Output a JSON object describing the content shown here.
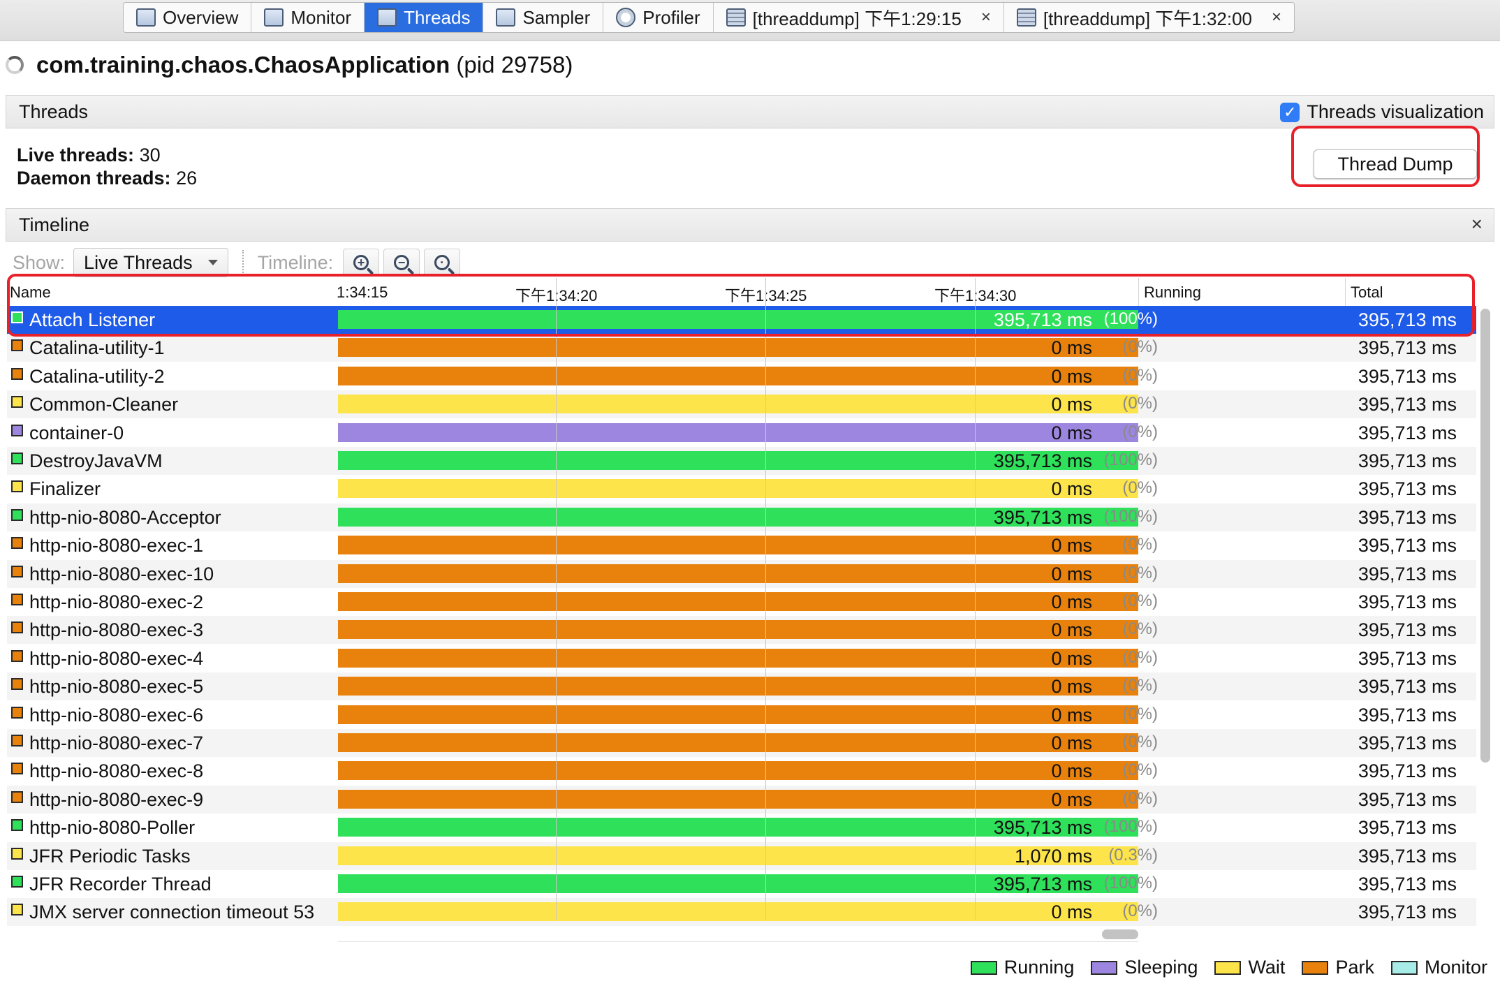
{
  "colors": {
    "running": "#2ee05a",
    "sleeping": "#9d86e0",
    "wait": "#fde44a",
    "park": "#e8820c",
    "monitor": "#a8ece8",
    "selection": "#1e5be8",
    "highlight": "#e8202a"
  },
  "tabs": [
    {
      "label": "Overview",
      "icon": "overview-icon"
    },
    {
      "label": "Monitor",
      "icon": "monitor-icon"
    },
    {
      "label": "Threads",
      "icon": "threads-icon",
      "active": true
    },
    {
      "label": "Sampler",
      "icon": "sampler-icon"
    },
    {
      "label": "Profiler",
      "icon": "profiler-icon"
    },
    {
      "label": "[threaddump] 下午1:29:15",
      "icon": "threaddump-icon",
      "closable": true
    },
    {
      "label": "[threaddump] 下午1:32:00",
      "icon": "threaddump-icon",
      "closable": true
    }
  ],
  "tab_close": "×",
  "app": {
    "name": "com.training.chaos.ChaosApplication",
    "pid": "(pid 29758)"
  },
  "threads_section": {
    "title": "Threads",
    "visualization_label": "Threads visualization",
    "visualization_checked": true,
    "live_label": "Live threads:",
    "live_value": "30",
    "daemon_label": "Daemon threads:",
    "daemon_value": "26",
    "dump_button": "Thread Dump"
  },
  "timeline_section": {
    "title": "Timeline",
    "close": "×",
    "show_label": "Show:",
    "show_value": "Live Threads",
    "timeline_label": "Timeline:",
    "zoom": [
      "zoom-in-icon",
      "zoom-out-icon",
      "zoom-fit-icon"
    ]
  },
  "columns": {
    "name": "Name",
    "ticks": [
      "1:34:15",
      "下午1:34:20",
      "下午1:34:25",
      "下午1:34:30"
    ],
    "running": "Running",
    "total": "Total"
  },
  "threads": [
    {
      "name": "Attach Listener",
      "state": "running",
      "running": "395,713 ms",
      "pct": "(100%)",
      "total": "395,713 ms",
      "selected": true
    },
    {
      "name": "Catalina-utility-1",
      "state": "park",
      "running": "0 ms",
      "pct": "(0%)",
      "total": "395,713 ms"
    },
    {
      "name": "Catalina-utility-2",
      "state": "park",
      "running": "0 ms",
      "pct": "(0%)",
      "total": "395,713 ms"
    },
    {
      "name": "Common-Cleaner",
      "state": "wait",
      "running": "0 ms",
      "pct": "(0%)",
      "total": "395,713 ms"
    },
    {
      "name": "container-0",
      "state": "sleeping",
      "running": "0 ms",
      "pct": "(0%)",
      "total": "395,713 ms"
    },
    {
      "name": "DestroyJavaVM",
      "state": "running",
      "running": "395,713 ms",
      "pct": "(100%)",
      "total": "395,713 ms"
    },
    {
      "name": "Finalizer",
      "state": "wait",
      "running": "0 ms",
      "pct": "(0%)",
      "total": "395,713 ms"
    },
    {
      "name": "http-nio-8080-Acceptor",
      "state": "running",
      "running": "395,713 ms",
      "pct": "(100%)",
      "total": "395,713 ms"
    },
    {
      "name": "http-nio-8080-exec-1",
      "state": "park",
      "running": "0 ms",
      "pct": "(0%)",
      "total": "395,713 ms"
    },
    {
      "name": "http-nio-8080-exec-10",
      "state": "park",
      "running": "0 ms",
      "pct": "(0%)",
      "total": "395,713 ms"
    },
    {
      "name": "http-nio-8080-exec-2",
      "state": "park",
      "running": "0 ms",
      "pct": "(0%)",
      "total": "395,713 ms"
    },
    {
      "name": "http-nio-8080-exec-3",
      "state": "park",
      "running": "0 ms",
      "pct": "(0%)",
      "total": "395,713 ms"
    },
    {
      "name": "http-nio-8080-exec-4",
      "state": "park",
      "running": "0 ms",
      "pct": "(0%)",
      "total": "395,713 ms"
    },
    {
      "name": "http-nio-8080-exec-5",
      "state": "park",
      "running": "0 ms",
      "pct": "(0%)",
      "total": "395,713 ms"
    },
    {
      "name": "http-nio-8080-exec-6",
      "state": "park",
      "running": "0 ms",
      "pct": "(0%)",
      "total": "395,713 ms"
    },
    {
      "name": "http-nio-8080-exec-7",
      "state": "park",
      "running": "0 ms",
      "pct": "(0%)",
      "total": "395,713 ms"
    },
    {
      "name": "http-nio-8080-exec-8",
      "state": "park",
      "running": "0 ms",
      "pct": "(0%)",
      "total": "395,713 ms"
    },
    {
      "name": "http-nio-8080-exec-9",
      "state": "park",
      "running": "0 ms",
      "pct": "(0%)",
      "total": "395,713 ms"
    },
    {
      "name": "http-nio-8080-Poller",
      "state": "running",
      "running": "395,713 ms",
      "pct": "(100%)",
      "total": "395,713 ms"
    },
    {
      "name": "JFR Periodic Tasks",
      "state": "wait",
      "running": "1,070 ms",
      "pct": "(0.3%)",
      "total": "395,713 ms"
    },
    {
      "name": "JFR Recorder Thread",
      "state": "running",
      "running": "395,713 ms",
      "pct": "(100%)",
      "total": "395,713 ms"
    },
    {
      "name": "JMX server connection timeout 53",
      "state": "wait",
      "running": "0 ms",
      "pct": "(0%)",
      "total": "395,713 ms"
    }
  ],
  "legend": [
    {
      "label": "Running",
      "state": "running"
    },
    {
      "label": "Sleeping",
      "state": "sleeping"
    },
    {
      "label": "Wait",
      "state": "wait"
    },
    {
      "label": "Park",
      "state": "park"
    },
    {
      "label": "Monitor",
      "state": "monitor"
    }
  ]
}
